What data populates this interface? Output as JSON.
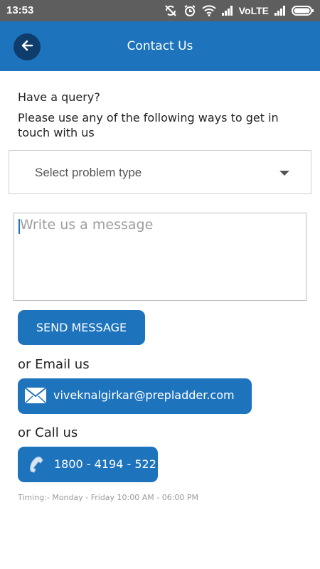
{
  "status_bar": {
    "time": "13:53",
    "network_label": "VoLTE",
    "icons": [
      "no-sync-icon",
      "alarm-icon",
      "wifi-icon",
      "signal-icon",
      "signal-icon",
      "battery-icon"
    ]
  },
  "app_bar": {
    "title": "Contact Us",
    "back_icon": "back-arrow-icon",
    "color": "#1e73bd"
  },
  "intro": {
    "query": "Have a query?",
    "instruction": "Please use any of the following ways to get in touch with us"
  },
  "problem_select": {
    "selected_value": "Select problem type"
  },
  "message": {
    "placeholder": "Write us a message"
  },
  "send_button": {
    "label": "SEND MESSAGE"
  },
  "email": {
    "heading": "or Email us",
    "address": "viveknalgirkar@prepladder.com",
    "icon": "envelope-icon"
  },
  "call": {
    "heading": "or Call us",
    "number": "1800 - 4194 - 522",
    "icon": "phone-icon"
  },
  "timing": "Timing:-  Monday - Friday 10:00 AM - 06:00 PM"
}
